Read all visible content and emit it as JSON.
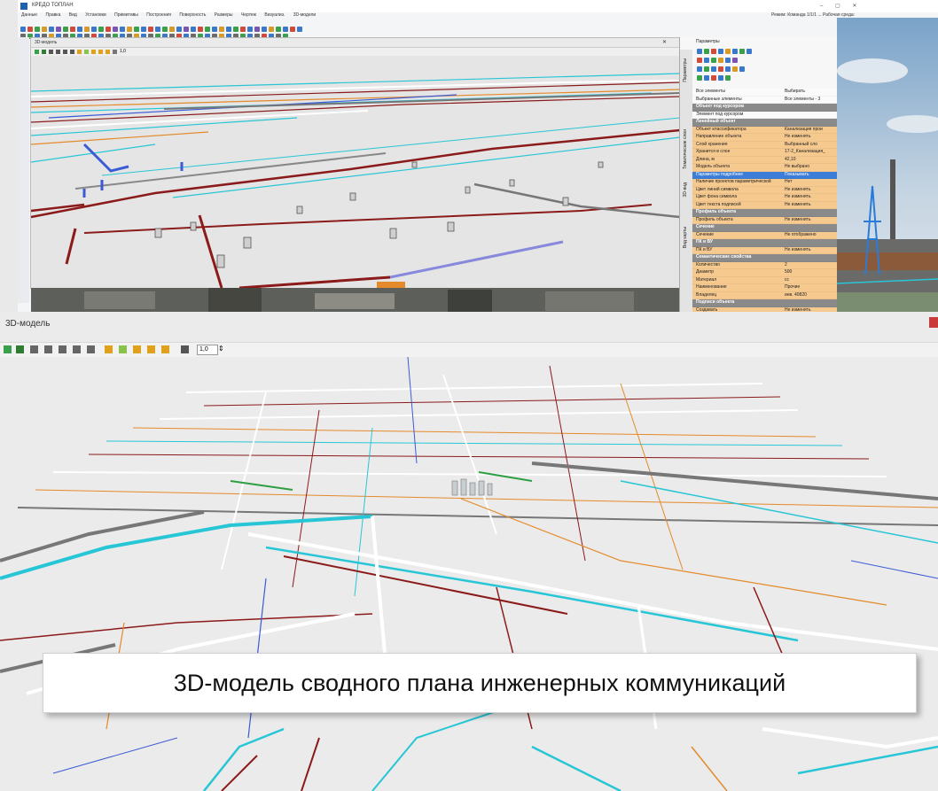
{
  "top_window": {
    "app_title": "КРЕДО ТОПЛАН",
    "menu_items": [
      "Данные",
      "Правка",
      "Вид",
      "Установки",
      "Примитивы",
      "Построения",
      "Поверхность",
      "Размеры",
      "Чертеж",
      "Визуализ.",
      "3D-модели"
    ],
    "right_controls": "Режим: Команда 1/1/1 ...   Рабочая среда:",
    "doc_title": "3D-модель",
    "zoom_value": "1,0",
    "params_panel": {
      "title": "Параметры",
      "vertical_tabs": [
        "Параметры",
        "Тематические слои",
        "3D-вид",
        "Вид карты"
      ],
      "rows": [
        {
          "key": "Все элементы",
          "value": "Выбирать",
          "style": "white"
        },
        {
          "key": "Выбранные элементы",
          "value": "Все элементы - 3",
          "style": "white"
        },
        {
          "key": "Объект под курсором",
          "value": "",
          "style": "hdr"
        },
        {
          "key": "Элемент под курсором",
          "value": "",
          "style": "white"
        },
        {
          "key": "Линейный объект",
          "value": "",
          "style": "hdr"
        },
        {
          "key": "Объект классификатора",
          "value": "Канализация прои",
          "style": "orange"
        },
        {
          "key": "Направление объекта",
          "value": "Не изменять",
          "style": "orange"
        },
        {
          "key": "Слой хранения",
          "value": "Выбранный сло",
          "style": "orange"
        },
        {
          "key": "Хранится в слое",
          "value": "17-2_Канализация_",
          "style": "orange"
        },
        {
          "key": "Длина, м",
          "value": "42,10",
          "style": "orange"
        },
        {
          "key": "Модель объекта",
          "value": "Не выбрано",
          "style": "orange"
        },
        {
          "key": "Параметры подробнее",
          "value": "Показывать",
          "style": "blue"
        },
        {
          "key": "Наличие проектов параметрической",
          "value": "Нет",
          "style": "orange"
        },
        {
          "key": "Цвет линий символа",
          "value": "Не изменять",
          "style": "orange"
        },
        {
          "key": "Цвет фона символа",
          "value": "Не изменять",
          "style": "orange"
        },
        {
          "key": "Цвет текста подписей",
          "value": "Не изменять",
          "style": "orange"
        },
        {
          "key": "Профиль объекта",
          "value": "",
          "style": "hdr"
        },
        {
          "key": "Профиль объекта",
          "value": "Не изменять",
          "style": "orange"
        },
        {
          "key": "Сечение",
          "value": "",
          "style": "hdr"
        },
        {
          "key": "Сечение",
          "value": "Не отображено",
          "style": "orange"
        },
        {
          "key": "ПК и ВУ",
          "value": "",
          "style": "hdr"
        },
        {
          "key": "ПК и ВУ",
          "value": "Не изменять",
          "style": "orange"
        },
        {
          "key": "Семантические свойства",
          "value": "",
          "style": "hdr"
        },
        {
          "key": "Количество",
          "value": "2",
          "style": "orange"
        },
        {
          "key": "Диаметр",
          "value": "500",
          "style": "orange"
        },
        {
          "key": "Материал",
          "value": "сс",
          "style": "orange"
        },
        {
          "key": "Наименование",
          "value": "Прочие",
          "style": "orange"
        },
        {
          "key": "Владелец",
          "value": "инв. 40820",
          "style": "orange"
        },
        {
          "key": "Подписи объекта",
          "value": "",
          "style": "hdr"
        },
        {
          "key": "Создавать",
          "value": "Не изменять",
          "style": "orange"
        }
      ]
    }
  },
  "bottom_window": {
    "title": "3D-модель",
    "zoom_value": "1,0"
  },
  "caption": "3D-модель сводного плана инженерных коммуникаций",
  "colors": {
    "pipe_red": "#8b1a1a",
    "pipe_cyan": "#27c6d6",
    "pipe_blue": "#3b5bd6",
    "pipe_orange": "#e48a2a",
    "background": "#ebebeb",
    "panel_orange": "#f6c98f",
    "panel_blue": "#3c7dd8"
  }
}
